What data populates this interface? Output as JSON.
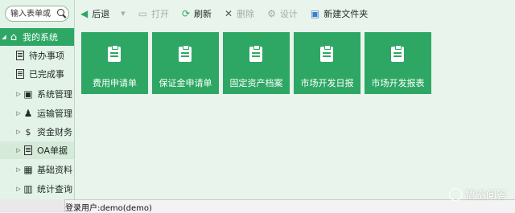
{
  "search": {
    "placeholder": "输入表单或",
    "icon": "search-icon"
  },
  "sidebar": {
    "root": {
      "label": "我的系统",
      "icon": "home-icon"
    },
    "items": [
      {
        "label": "待办事项",
        "icon": "document-icon"
      },
      {
        "label": "已完成事",
        "icon": "document-icon"
      },
      {
        "label": "系统管理",
        "icon": "folder-icon"
      },
      {
        "label": "运输管理",
        "icon": "user-add-icon"
      },
      {
        "label": "资金财务",
        "icon": "money-icon"
      },
      {
        "label": "OA单据",
        "icon": "clipboard-icon"
      },
      {
        "label": "基础资料",
        "icon": "grid-icon"
      },
      {
        "label": "统计查询",
        "icon": "bar-chart-icon"
      }
    ]
  },
  "toolbar": {
    "back": "后退",
    "open": "打开",
    "refresh": "刷新",
    "delete": "删除",
    "design": "设计",
    "new_folder": "新建文件夹"
  },
  "tiles": [
    {
      "label": "费用申请单"
    },
    {
      "label": "保证金申请单"
    },
    {
      "label": "固定资产档案"
    },
    {
      "label": "市场开发日报"
    },
    {
      "label": "市场开发报表"
    }
  ],
  "status": {
    "user": "登录用户:demo(demo)"
  },
  "watermark": {
    "text": "悟空问答"
  },
  "colors": {
    "accent": "#2ea764",
    "background": "#e9f4ec"
  }
}
